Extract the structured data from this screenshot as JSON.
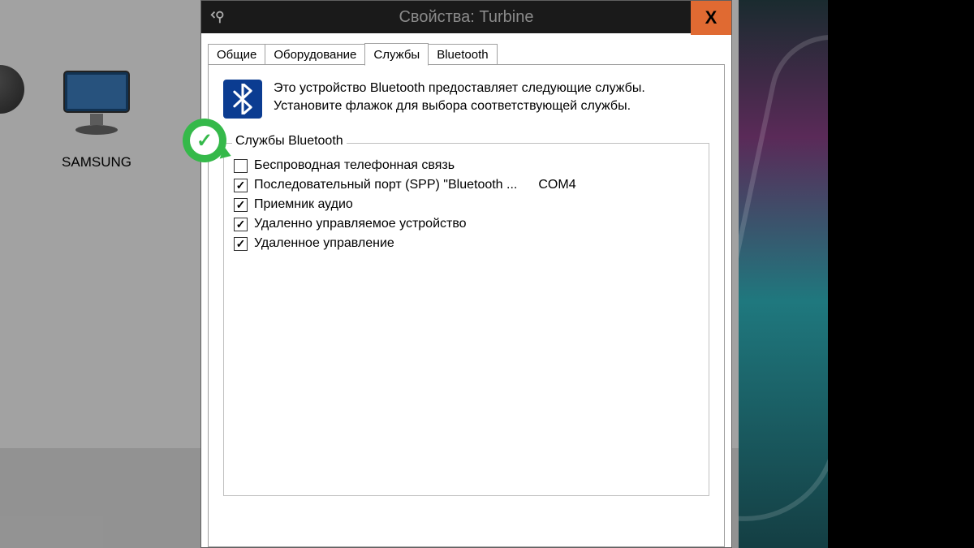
{
  "desktop": {
    "monitor_label": "SAMSUNG"
  },
  "dialog": {
    "title": "Свойства: Turbine",
    "close_label": "X",
    "tabs": [
      {
        "label": "Общие"
      },
      {
        "label": "Оборудование"
      },
      {
        "label": "Службы"
      },
      {
        "label": "Bluetooth"
      }
    ],
    "intro_line1": "Это устройство Bluetooth предоставляет следующие службы.",
    "intro_line2": "Установите флажок для выбора соответствующей службы.",
    "group_title": "Службы Bluetooth",
    "services": [
      {
        "checked": false,
        "label": "Беспроводная телефонная связь",
        "extra": ""
      },
      {
        "checked": true,
        "label": "Последовательный порт (SPP) \"Bluetooth ...",
        "extra": "COM4"
      },
      {
        "checked": true,
        "label": "Приемник аудио",
        "extra": ""
      },
      {
        "checked": true,
        "label": "Удаленно управляемое устройство",
        "extra": ""
      },
      {
        "checked": true,
        "label": "Удаленное управление",
        "extra": ""
      }
    ]
  }
}
